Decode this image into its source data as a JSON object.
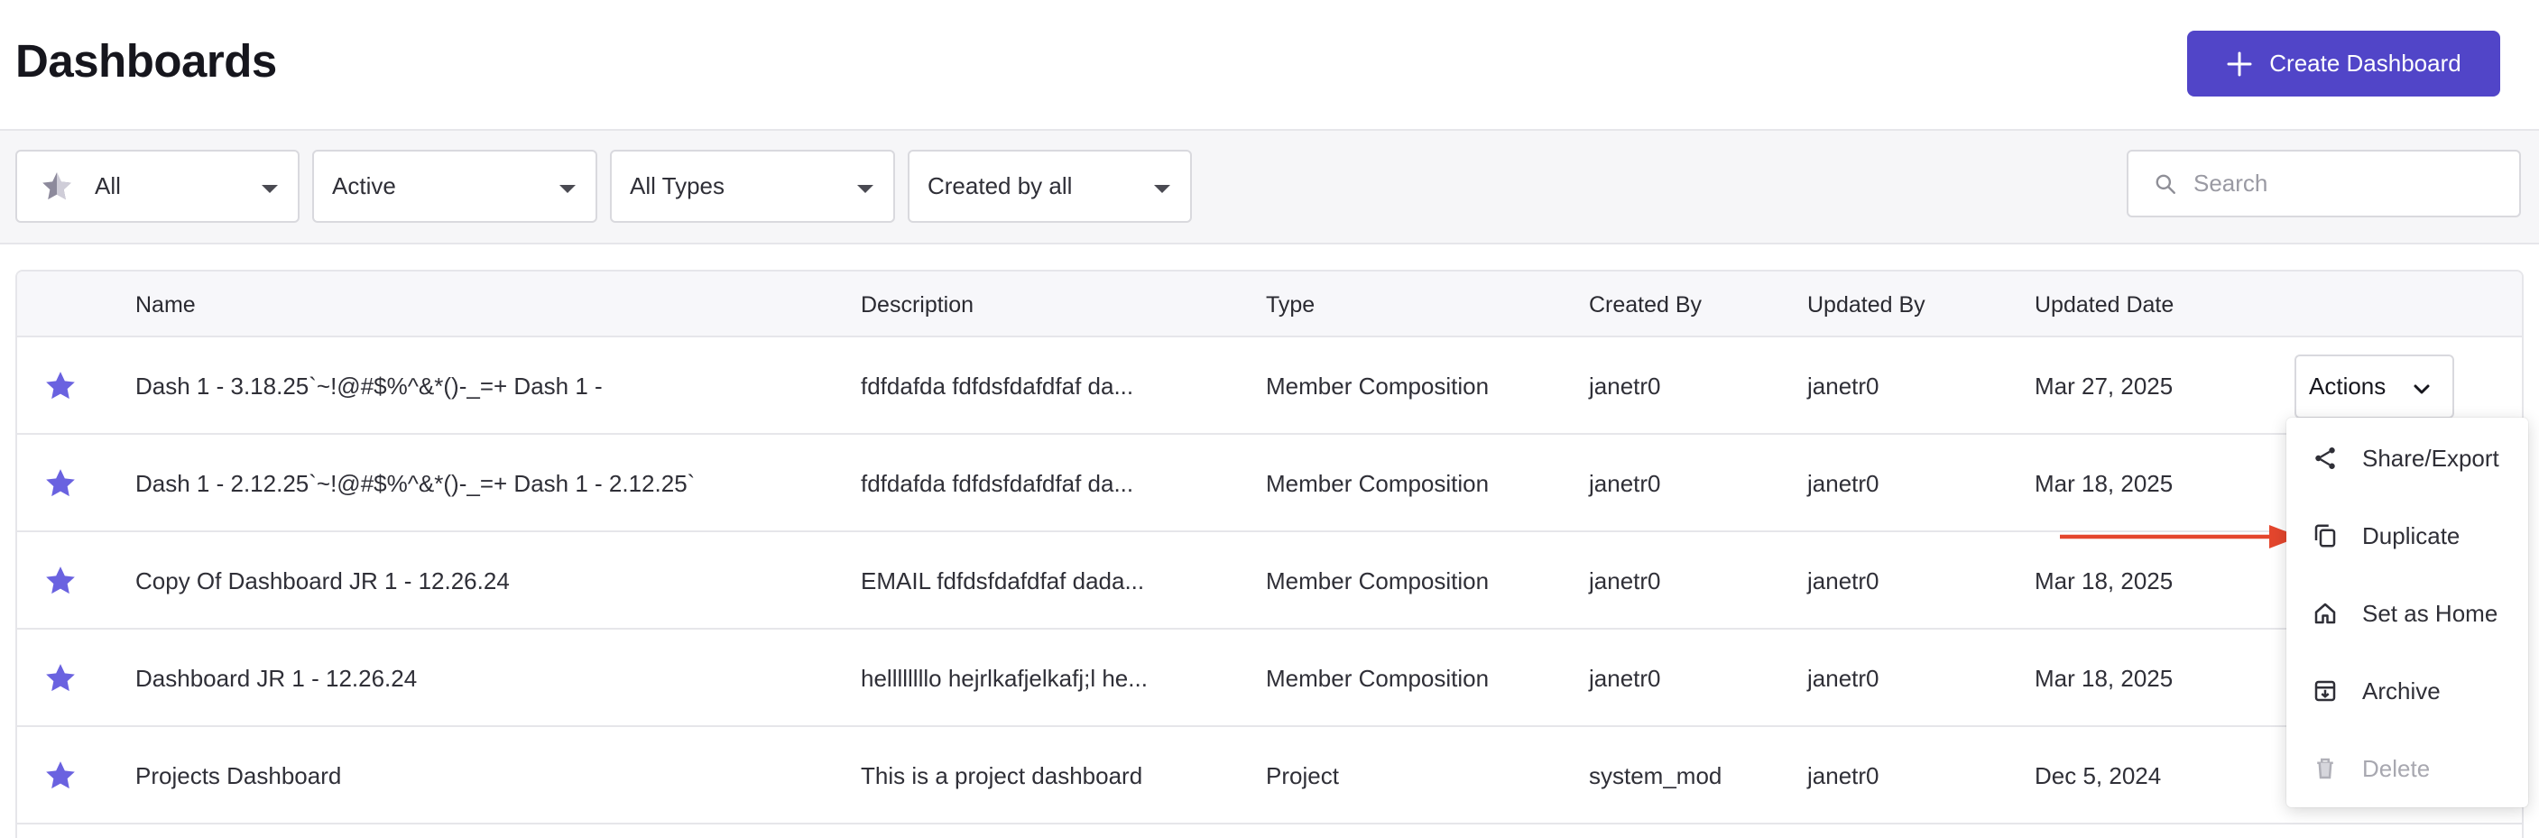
{
  "header": {
    "title": "Dashboards",
    "create_button_label": "Create Dashboard"
  },
  "filters": {
    "favorites": "All",
    "status": "Active",
    "type": "All Types",
    "creator": "Created by all",
    "search_placeholder": "Search"
  },
  "table": {
    "columns": {
      "name": "Name",
      "description": "Description",
      "type": "Type",
      "created_by": "Created By",
      "updated_by": "Updated By",
      "updated_date": "Updated Date"
    },
    "rows": [
      {
        "name": "Dash 1 - 3.18.25`~!@#$%^&*()-_=+ Dash 1 -",
        "description": "fdfdafda fdfdsfdafdfaf da...",
        "type": "Member Composition",
        "created_by": "janetr0",
        "updated_by": "janetr0",
        "updated_date": "Mar 27, 2025"
      },
      {
        "name": "Dash 1 - 2.12.25`~!@#$%^&*()-_=+ Dash 1 - 2.12.25`",
        "description": "fdfdafda fdfdsfdafdfaf da...",
        "type": "Member Composition",
        "created_by": "janetr0",
        "updated_by": "janetr0",
        "updated_date": "Mar 18, 2025"
      },
      {
        "name": "Copy Of Dashboard JR 1 - 12.26.24",
        "description": "EMAIL fdfdsfdafdfaf dada...",
        "type": "Member Composition",
        "created_by": "janetr0",
        "updated_by": "janetr0",
        "updated_date": "Mar 18, 2025"
      },
      {
        "name": "Dashboard JR 1 - 12.26.24",
        "description": "hellllllllo hejrlkafjelkafj;l he...",
        "type": "Member Composition",
        "created_by": "janetr0",
        "updated_by": "janetr0",
        "updated_date": "Mar 18, 2025"
      },
      {
        "name": "Projects Dashboard",
        "description": "This is a project dashboard",
        "type": "Project",
        "created_by": "system_mod",
        "updated_by": "janetr0",
        "updated_date": "Dec 5, 2024"
      }
    ],
    "actions_label": "Actions"
  },
  "actions_menu": {
    "items": [
      {
        "label": "Share/Export",
        "icon": "share-icon",
        "disabled": false
      },
      {
        "label": "Duplicate",
        "icon": "copy-icon",
        "disabled": false
      },
      {
        "label": "Set as Home",
        "icon": "home-icon",
        "disabled": false
      },
      {
        "label": "Archive",
        "icon": "archive-icon",
        "disabled": false
      },
      {
        "label": "Delete",
        "icon": "trash-icon",
        "disabled": true
      }
    ]
  },
  "colors": {
    "accent": "#5145c8",
    "star": "#6a62e0",
    "annotation_arrow": "#e4462d"
  }
}
